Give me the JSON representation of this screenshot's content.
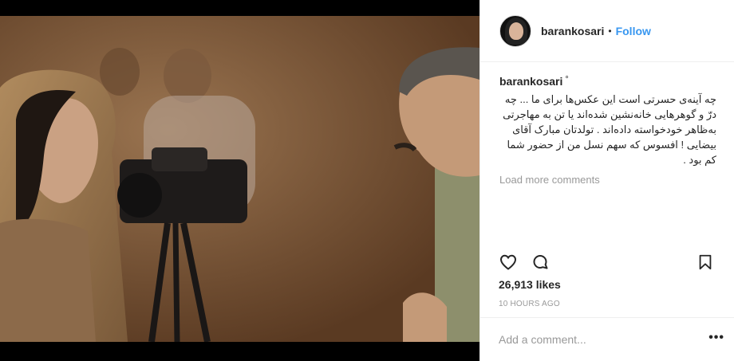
{
  "post": {
    "username": "barankosari",
    "separator": "•",
    "follow_label": "Follow",
    "comment_author": "barankosari",
    "comment_badge": "°",
    "caption": "چه آینه‌ی حسرتی است این عکس‌ها برای ما ... چه درّ و گوهرهایی خانه‌نشین شده‌اند یا تن به مهاجرتی به‌ظاهر خودخواسته داده‌اند . تولدتان مبارک آقای بیضایی ! افسوس که سهم نسل من از حضور شما کم بود .",
    "load_more_label": "Load more comments",
    "likes": "26,913 likes",
    "time_ago": "10 HOURS AGO",
    "add_comment_placeholder": "Add a comment...",
    "more_label": "•••"
  },
  "icons": {
    "like": "heart-icon",
    "comment": "comment-icon",
    "save": "bookmark-icon",
    "options": "more-options-icon"
  },
  "colors": {
    "accent": "#3897f0",
    "text": "#262626",
    "muted": "#999999",
    "border": "#efefef"
  }
}
